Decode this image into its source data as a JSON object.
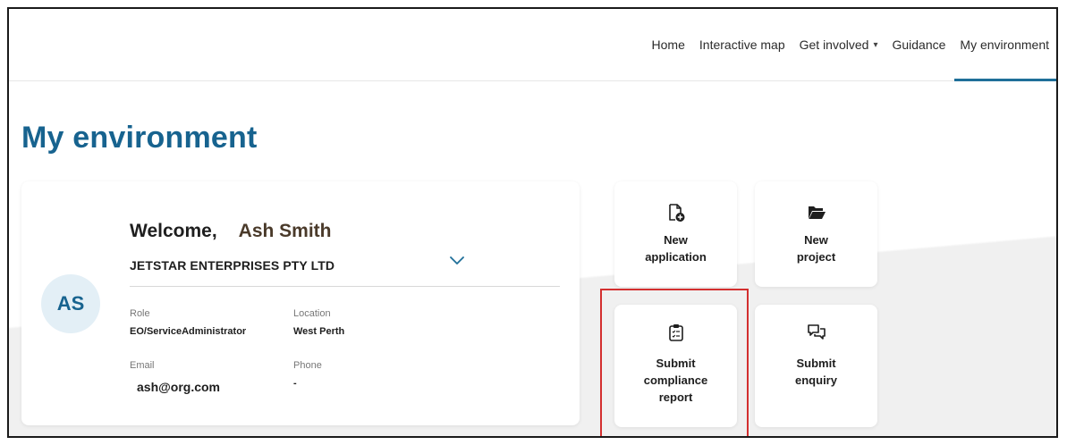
{
  "nav": {
    "items": [
      {
        "label": "Home"
      },
      {
        "label": "Interactive map"
      },
      {
        "label": "Get involved",
        "dropdown": true
      },
      {
        "label": "Guidance"
      },
      {
        "label": "My environment",
        "active": true
      }
    ]
  },
  "page": {
    "title": "My environment"
  },
  "profile": {
    "avatar_initials": "AS",
    "welcome": "Welcome,",
    "name": "Ash Smith",
    "organisation": "JETSTAR ENTERPRISES PTY LTD",
    "role_label": "Role",
    "role": "EO/ServiceAdministrator",
    "location_label": "Location",
    "location": "West Perth",
    "email_label": "Email",
    "email": "ash@org.com",
    "phone_label": "Phone",
    "phone": "-"
  },
  "tiles": {
    "new_application": {
      "line1": "New",
      "line2": "application",
      "icon": "file-plus-icon"
    },
    "new_project": {
      "line1": "New",
      "line2": "project",
      "icon": "folder-open-icon"
    },
    "submit_compliance": {
      "line1": "Submit",
      "line2": "compliance",
      "line3": "report",
      "icon": "clipboard-checklist-icon"
    },
    "submit_enquiry": {
      "line1": "Submit",
      "line2": "enquiry",
      "icon": "chat-bubbles-icon"
    }
  },
  "colors": {
    "brand": "#17638f",
    "nav_active_underline": "#1f6f99",
    "highlight": "#d32f2f",
    "avatar_bg": "#e3eff6"
  }
}
